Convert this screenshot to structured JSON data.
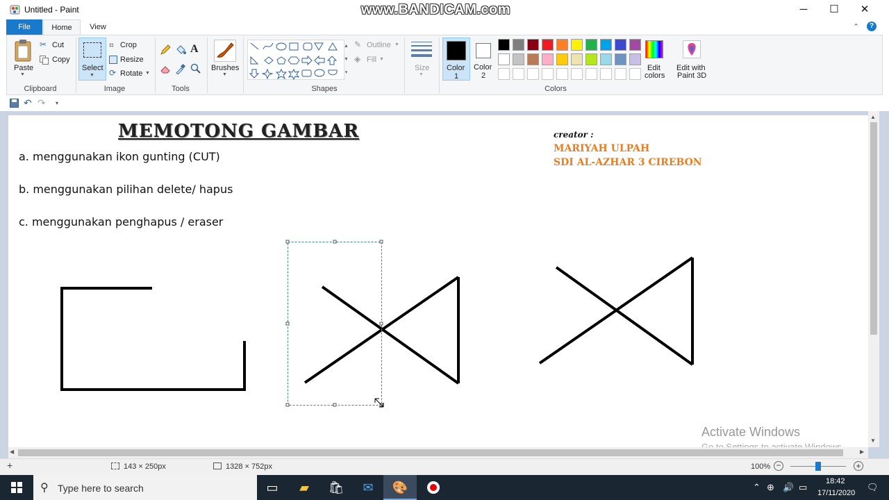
{
  "window": {
    "title": "Untitled - Paint",
    "watermark": "www.BANDICAM.com",
    "minimize_glyph": "─",
    "maximize_glyph": "☐",
    "close_glyph": "✕"
  },
  "tabs": {
    "file": "File",
    "home": "Home",
    "view": "View"
  },
  "ribbon": {
    "clipboard": {
      "paste": "Paste",
      "cut": "Cut",
      "copy": "Copy",
      "group": "Clipboard"
    },
    "image": {
      "select": "Select",
      "crop": "Crop",
      "resize": "Resize",
      "rotate": "Rotate",
      "group": "Image"
    },
    "tools": {
      "group": "Tools",
      "text_glyph": "A"
    },
    "brushes": {
      "label": "Brushes"
    },
    "shapes": {
      "outline": "Outline",
      "fill": "Fill",
      "group": "Shapes"
    },
    "size": {
      "label": "Size"
    },
    "colors": {
      "color1": "Color",
      "color1_num": "1",
      "color2": "Color",
      "color2_num": "2",
      "edit_line1": "Edit",
      "edit_line2": "colors",
      "paint3d_line1": "Edit with",
      "paint3d_line2": "Paint 3D",
      "group": "Colors",
      "color1_value": "#000000",
      "color2_value": "#ffffff",
      "palette_row1": [
        "#000000",
        "#7f7f7f",
        "#880015",
        "#ed1c24",
        "#ff7f27",
        "#fff200",
        "#22b14c",
        "#00a2e8",
        "#3f48cc",
        "#a349a4"
      ],
      "palette_row2": [
        "#ffffff",
        "#c3c3c3",
        "#b97a57",
        "#ffaec9",
        "#ffc90e",
        "#efe4b0",
        "#b5e61d",
        "#99d9ea",
        "#7092be",
        "#c8bfe7"
      ]
    }
  },
  "document": {
    "title": "MEMOTONG GAMBAR",
    "line_a": "a. menggunakan ikon gunting (CUT)",
    "line_b": "b. menggunakan pilihan delete/ hapus",
    "line_c": "c. menggunakan penghapus / eraser",
    "creator_label": "creator :",
    "creator_name": "MARIYAH ULPAH",
    "creator_school": "SDI AL-AZHAR 3 CIREBON",
    "activate_title": "Activate Windows",
    "activate_sub": "Go to Settings to activate Windows."
  },
  "status": {
    "selection_size": "143 × 250px",
    "canvas_size": "1328 × 752px",
    "zoom": "100%"
  },
  "taskbar": {
    "search_placeholder": "Type here to search",
    "time": "18:42",
    "date": "17/11/2020"
  }
}
